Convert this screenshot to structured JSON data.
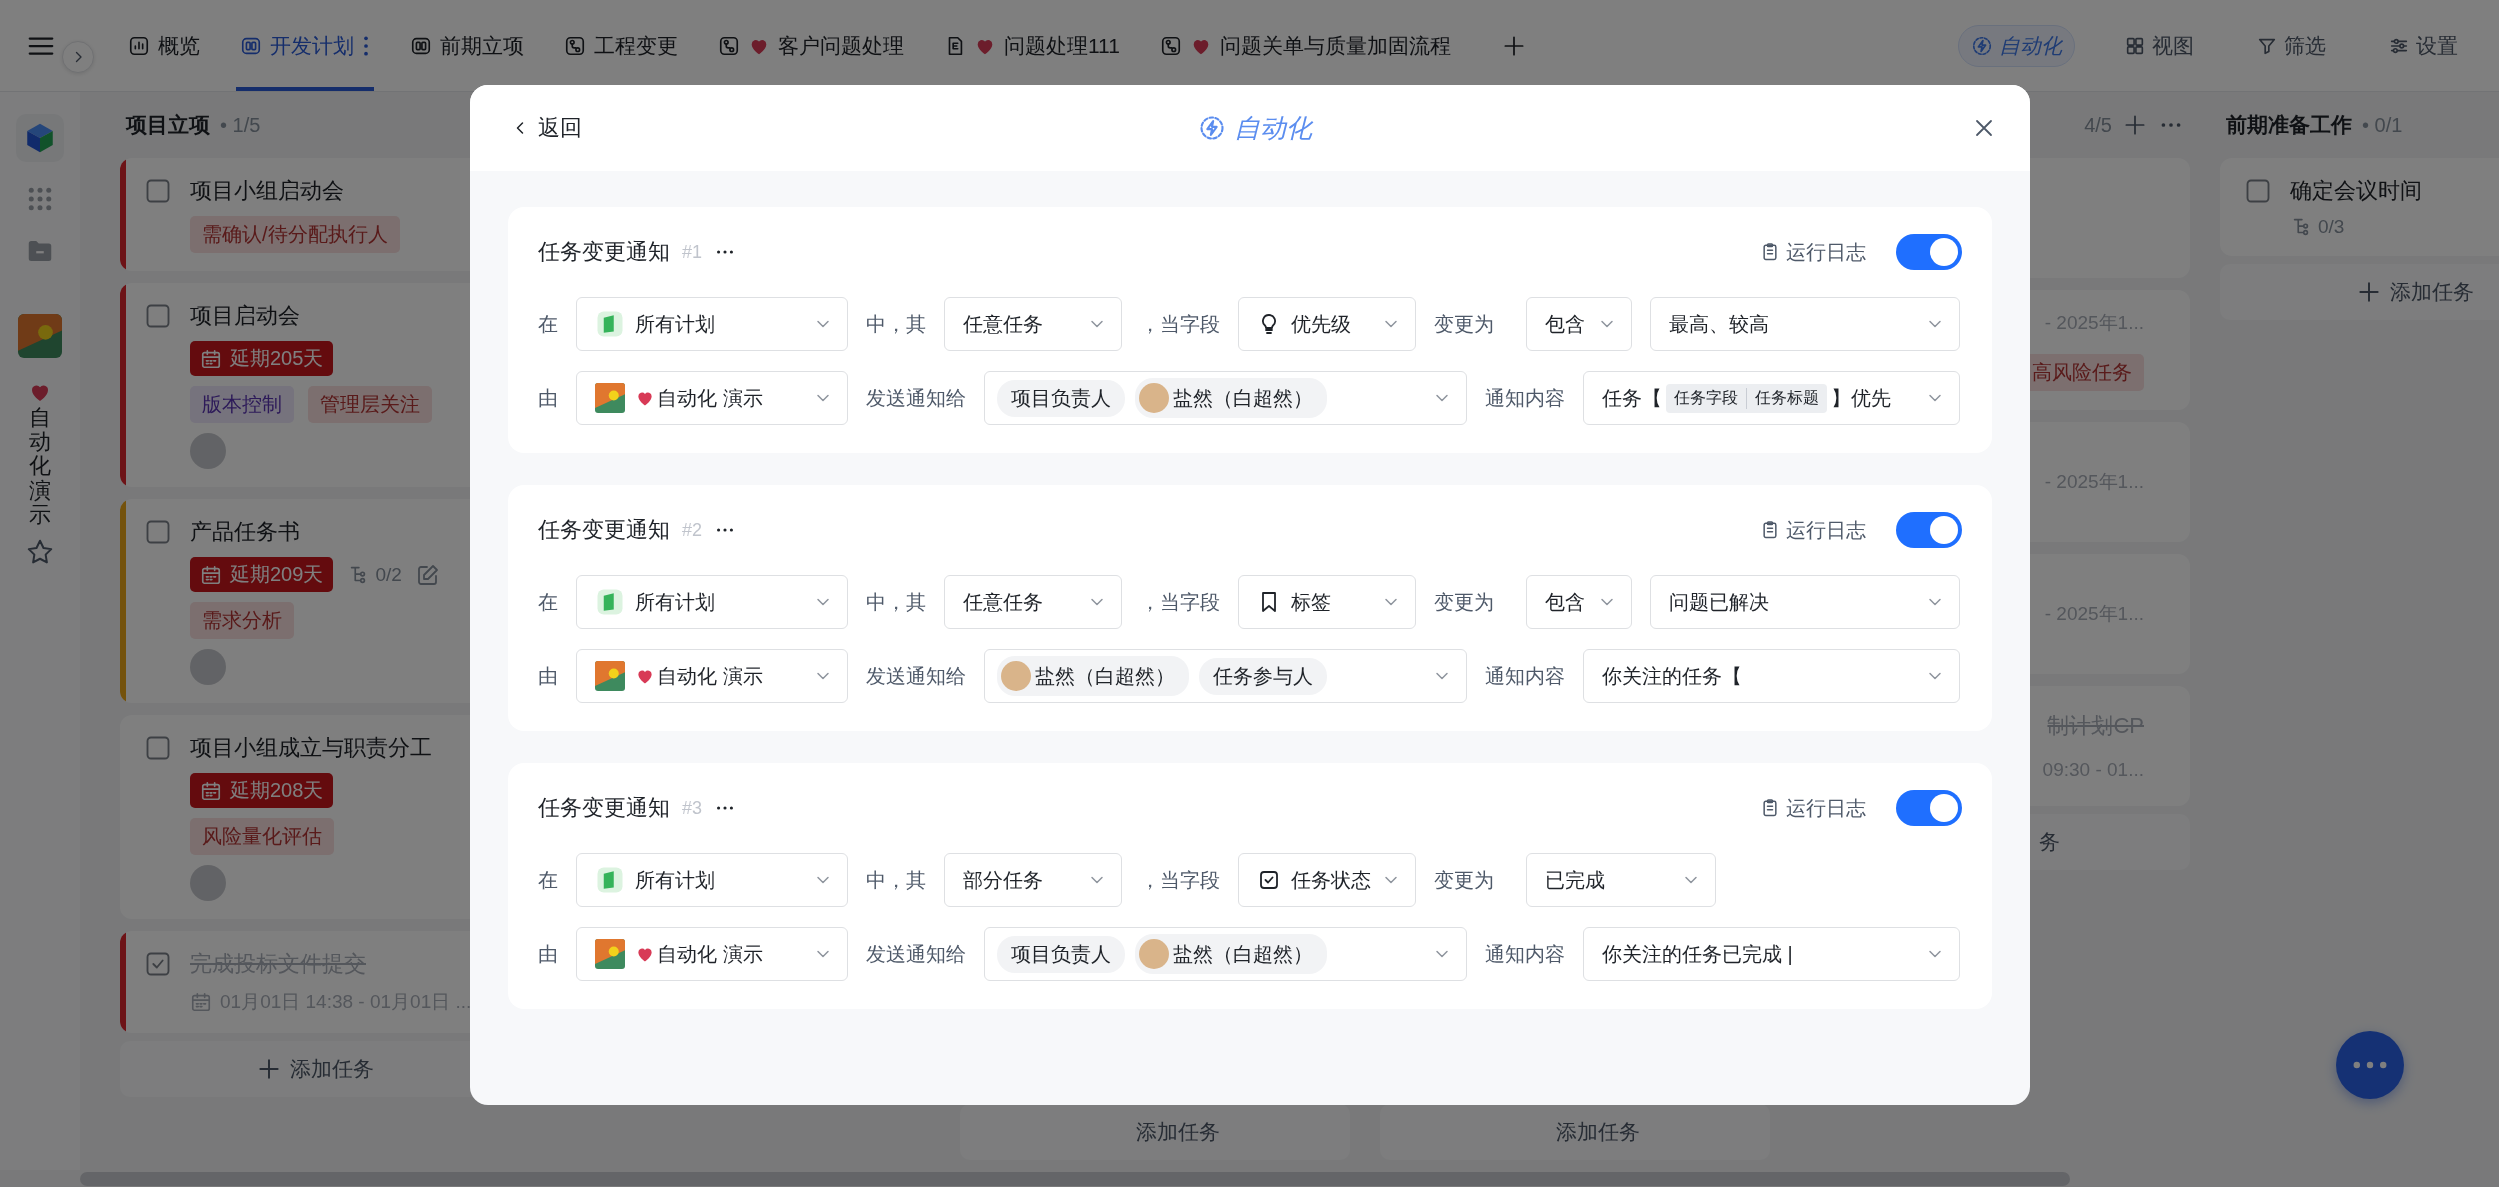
{
  "topbar": {
    "tabs": [
      {
        "label": "概览",
        "selected": false
      },
      {
        "label": "开发计划",
        "selected": true
      },
      {
        "label": "前期立项",
        "selected": false
      },
      {
        "label": "工程变更",
        "selected": false
      },
      {
        "label": "客户问题处理",
        "favorite": true,
        "selected": false
      },
      {
        "label": "问题处理111",
        "favorite": true,
        "selected": false
      },
      {
        "label": "问题关单与质量加固流程",
        "favorite": true,
        "selected": false
      }
    ],
    "actions": [
      {
        "label": "自动化",
        "selected": true
      },
      {
        "label": "视图",
        "selected": false
      },
      {
        "label": "筛选",
        "selected": false
      },
      {
        "label": "设置",
        "selected": false
      }
    ]
  },
  "sidebar": {
    "project_name": "自动化演示"
  },
  "board": {
    "columns": [
      {
        "title": "项目立项",
        "count": "• 1/5",
        "add_label": "添加任务",
        "cards": [
          {
            "kind": "task",
            "title": "项目小组启动会",
            "checked": false,
            "color": "#6d1317",
            "tags": [
              {
                "text": "需确认/待分配执行人",
                "color": "#7c6f6f"
              }
            ]
          },
          {
            "kind": "task",
            "title": "项目启动会",
            "checked": false,
            "color": "#6d1317",
            "delay": "延期205天",
            "avatar": true,
            "tags": [
              {
                "text": "版本控制",
                "color": "#76737d"
              },
              {
                "text": "管理层关注",
                "color": "#7c6f6f"
              }
            ]
          },
          {
            "kind": "task",
            "title": "产品任务书",
            "checked": false,
            "color": "#74520c",
            "delay": "延期209天",
            "subtasks": "0/2",
            "edit_icon": true,
            "avatar": true,
            "tags": [
              {
                "text": "需求分析",
                "color": "#7c6f6f"
              }
            ]
          },
          {
            "kind": "task",
            "title": "项目小组成立与职责分工",
            "checked": false,
            "delay": "延期208天",
            "avatar": true,
            "tags": [
              {
                "text": "风险量化评估",
                "color": "#7c6f6f"
              }
            ]
          },
          {
            "kind": "task",
            "title": "完成投标文件提交",
            "checked": true,
            "color": "#6d1317",
            "date": "01月01日 14:38 - 01月01日 ..."
          }
        ]
      },
      {},
      {
        "add_label": "添加任务"
      },
      {
        "add_label": "添加任务"
      },
      {
        "count": "4/5",
        "add_label": "务",
        "cards": [
          {
            "kind": "partial"
          },
          {
            "kind": "partial",
            "fragments": [
              {
                "kind": "date",
                "text": "- 2025年1..."
              },
              {
                "kind": "tag",
                "text": "高风险任务",
                "color": "#7c6f6f"
              }
            ]
          },
          {
            "kind": "partial",
            "fragments": [
              {
                "kind": "date",
                "text": "- 2025年1..."
              }
            ]
          },
          {
            "kind": "partial",
            "fragments": [
              {
                "kind": "date",
                "text": "- 2025年1..."
              }
            ]
          },
          {
            "kind": "partial",
            "fragments": [
              {
                "kind": "done",
                "text": "制计划CP"
              },
              {
                "kind": "date",
                "text": "09:30 - 01..."
              }
            ]
          }
        ]
      },
      {
        "title": "前期准备工作",
        "count": "• 0/1",
        "add_label": "添加任务",
        "cards": [
          {
            "kind": "task",
            "title": "确定会议时间",
            "checked": false,
            "subtasks": "0/3"
          }
        ]
      }
    ]
  },
  "modal": {
    "back": "返回",
    "title": "自动化",
    "rules": [
      {
        "title": "任务变更通知",
        "number": "#1",
        "log": "运行日志",
        "enabled": true,
        "condition": {
          "prefix": "在",
          "scope": "所有计划",
          "mid": "中，其",
          "task_filter": "任意任务",
          "field_label": "，当字段",
          "field": "优先级",
          "change_label": "变更为",
          "values": [
            {
              "kind": "operator",
              "text": "包含"
            },
            {
              "kind": "value",
              "text": "最高、较高"
            }
          ]
        },
        "action": {
          "prefix": "由",
          "sender": "自动化 演示",
          "send_label": "发送通知给",
          "recipients": [
            {
              "kind": "role",
              "text": "项目负责人"
            },
            {
              "kind": "user",
              "text": "盐然（白超然）"
            }
          ],
          "content_label": "通知内容",
          "content": [
            {
              "kind": "text",
              "text": "任务【"
            },
            {
              "kind": "chip",
              "parts": [
                "任务字段",
                "任务标题"
              ]
            },
            {
              "kind": "text",
              "text": "】优先"
            }
          ]
        }
      },
      {
        "title": "任务变更通知",
        "number": "#2",
        "log": "运行日志",
        "enabled": true,
        "condition": {
          "prefix": "在",
          "scope": "所有计划",
          "mid": "中，其",
          "task_filter": "任意任务",
          "field_label": "，当字段",
          "field": "标签",
          "change_label": "变更为",
          "values": [
            {
              "kind": "operator",
              "text": "包含"
            },
            {
              "kind": "value",
              "text": "问题已解决"
            }
          ]
        },
        "action": {
          "prefix": "由",
          "sender": "自动化 演示",
          "send_label": "发送通知给",
          "recipients": [
            {
              "kind": "user",
              "text": "盐然（白超然）"
            },
            {
              "kind": "role",
              "text": "任务参与人"
            }
          ],
          "content_label": "通知内容",
          "content": [
            {
              "kind": "text",
              "text": "你关注的任务【"
            }
          ]
        }
      },
      {
        "title": "任务变更通知",
        "number": "#3",
        "log": "运行日志",
        "enabled": true,
        "condition": {
          "prefix": "在",
          "scope": "所有计划",
          "mid": "中，其",
          "task_filter": "部分任务",
          "field_label": "，当字段",
          "field": "任务状态",
          "change_label": "变更为",
          "values": [
            {
              "kind": "status",
              "text": "已完成"
            }
          ]
        },
        "action": {
          "prefix": "由",
          "sender": "自动化 演示",
          "send_label": "发送通知给",
          "recipients": [
            {
              "kind": "role",
              "text": "项目负责人"
            },
            {
              "kind": "user",
              "text": "盐然（白超然）"
            }
          ],
          "content_label": "通知内容",
          "content": [
            {
              "kind": "text",
              "text": "你关注的任务已完成 |"
            }
          ]
        }
      }
    ]
  }
}
